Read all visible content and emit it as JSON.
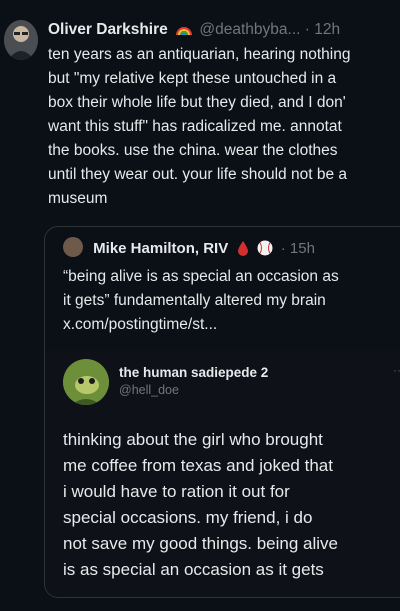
{
  "tweet": {
    "author_name": "Oliver Darkshire",
    "author_handle": "@deathbyba...",
    "separator": "·",
    "time": "12h",
    "more": "·",
    "lines": [
      "ten years as an antiquarian, hearing nothing",
      "but \"my relative kept these untouched in a",
      "box their whole life but they died, and I don'",
      "want this stuff\" has radicalized me. annotat",
      "the books. use the china. wear the clothes",
      "until they wear out. your life should not be a",
      "museum"
    ]
  },
  "quote": {
    "author_name": "Mike Hamilton, RIV",
    "separator": "·",
    "time": "15h",
    "lines": [
      "“being alive is as special an occasion as",
      "it gets” fundamentally altered my brain",
      "x.com/postingtime/st..."
    ],
    "screenshot": {
      "name": "the human sadiepede 2",
      "handle": "@hell_doe",
      "more": "···",
      "lines": [
        "thinking about the girl who brought",
        "me coffee from texas and joked that",
        "i would have to ration it out for",
        "special occasions. my friend, i do",
        "not save my good things. being alive",
        "is as special an occasion as it gets"
      ]
    }
  }
}
